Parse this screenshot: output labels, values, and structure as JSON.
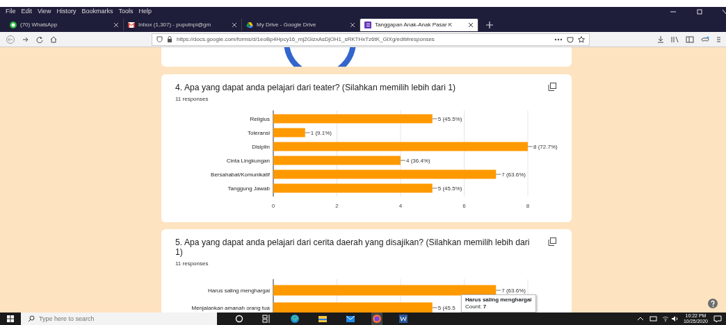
{
  "browser": {
    "menu": [
      "File",
      "Edit",
      "View",
      "History",
      "Bookmarks",
      "Tools",
      "Help"
    ],
    "tabs": [
      {
        "kind": "chat",
        "title": "(70) WhatsApp",
        "selected": false
      },
      {
        "kind": "mail",
        "title": "Inbox (1,307) - puputnpi@gm",
        "selected": false
      },
      {
        "kind": "drive",
        "title": "My Drive - Google Drive",
        "selected": false
      },
      {
        "kind": "form",
        "title": "Tanggapan Anak-Anak Pasar K",
        "selected": true
      }
    ],
    "url": "https://docs.google.com/forms/d/1eoBp4Hpcy16_mj2GlzxAsDjOH1_sRKTHxTz6tK_GlXg/edit#responses"
  },
  "questions": [
    {
      "title": "4. Apa yang dapat anda pelajari dari teater? (Silahkan memilih lebih dari 1)",
      "responses": "11 responses",
      "chart_data": {
        "type": "bar",
        "orientation": "horizontal",
        "categories": [
          "Religius",
          "Toleransi",
          "Disiplin",
          "Cinta Lingkungan",
          "Bersahabat/Komunikatif",
          "Tanggung Jawab"
        ],
        "values": [
          5,
          1,
          8,
          4,
          7,
          5
        ],
        "xlim": [
          0,
          8
        ],
        "xticks": [
          0,
          2,
          4,
          6,
          8
        ],
        "grid": true,
        "value_labels": [
          "5 (45.5%)",
          "1 (9.1%)",
          "8 (72.7%)",
          "4 (36.4%)",
          "7 (63.6%)",
          "5 (45.5%)"
        ]
      }
    },
    {
      "title": "5. Apa yang dapat anda pelajari dari cerita daerah yang disajikan? (Silahkan memilih lebih dari 1)",
      "responses": "11 responses",
      "chart_data": {
        "type": "bar",
        "orientation": "horizontal",
        "categories": [
          "Harus saling menghargai",
          "Menjalankan amanah orang tua"
        ],
        "values": [
          7,
          5
        ],
        "xlim": [
          0,
          8
        ],
        "grid": true,
        "value_labels": [
          "7 (63.6%)",
          "5 (45.5"
        ]
      },
      "tooltip": {
        "title": "Harus saling menghargai",
        "text": "Count: **7**"
      }
    }
  ],
  "taskbar": {
    "search": {
      "placeholder": "Type here to search"
    },
    "time": "10:22 PM",
    "date": "10/25/2020"
  }
}
